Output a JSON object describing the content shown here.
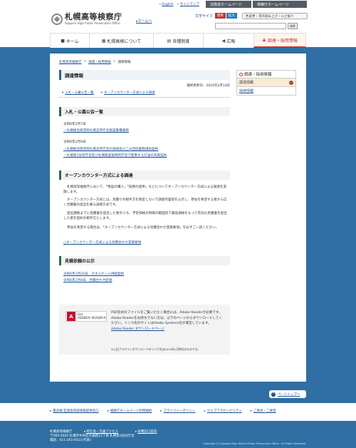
{
  "header": {
    "logo_jp": "札幌高等検察庁",
    "logo_en": "Sapporo High Public Prosecutors Office",
    "home_link": "ホームへ",
    "top_links": [
      "English",
      "サイトマップ"
    ],
    "moj_tab": "法務省ホームページ",
    "kensatsu_tab": "検察庁ホームページ",
    "font_size_label": "文字サイズ",
    "font_std": "標準",
    "font_big": "拡大",
    "ua_button": "色変更・音声読み上げ・ルビ振り",
    "search_button": "検索",
    "search_value": ""
  },
  "gnav": [
    {
      "icon": "home-icon",
      "glyph": "■",
      "label": "ホーム",
      "active": false
    },
    {
      "icon": "building-icon",
      "glyph": "▦",
      "label": "札幌高検について",
      "active": false
    },
    {
      "icon": "system-icon",
      "glyph": "▤",
      "label": "各種制度",
      "active": false
    },
    {
      "icon": "megaphone-icon",
      "glyph": "◀",
      "label": "広報",
      "active": false
    },
    {
      "icon": "person-icon",
      "glyph": "♟",
      "label": "調達・採用情報",
      "active": true
    }
  ],
  "breadcrumb": [
    "札幌高等検察庁",
    "調達・採用情報",
    "調達情報"
  ],
  "page_title": "調達情報",
  "updated": "最終更新日：2024年2月14日",
  "anchors": [
    "入札・公募公告一覧",
    "オープンカウンター方式による調達"
  ],
  "sec1": {
    "title": "入札・公募公告一覧",
    "date1": "令和6年2月7日",
    "link1": "・札幌総合研究所札幌支所庁舎施設警備業務",
    "date2": "令和6年2月9日",
    "link2": "・札幌総合研究所札幌支所庁舎の清掃及びごみ回収業務請負契約",
    "link3": "・札幌第3合同庁舎及び札幌家庭裁判所庁舎で使用する灯油の売買契約"
  },
  "sec2": {
    "title": "オープンカウンター方式による調達",
    "p1": "札幌高等検察庁において、「物品の購入」「役務の提供」などについてオープンカウンター方式による調達を実施します。",
    "p2": "オープンカウンター方式とは、見積りの相手方を限定しないで調達内容等を公示し、参加を希望する者から広く見積書の提出を募る調達方式です。",
    "p3": "提出期限までに見積書を提出した者のうち、予定価格の制限の範囲内で最低価格をもって有効な見積書を提出した者を契約の相手方とします。",
    "p4": "参加を希望する場合は、「オープンカウンター方式による見積合わせ実施要領」を必ずご一読ください。",
    "link": "○オープンカウンター方式による見積合わせ実施要領"
  },
  "sec3": {
    "title": "見積依頼の公示",
    "link1": "令和6年1月24日　タオルケット供給契約",
    "link2": "令和6年2月8日　見積合わせ結果"
  },
  "adobe": {
    "logo_small": "Get",
    "logo_text": "ADOBE® READER®",
    "line1": "PDF形式のファイルをご覧いただく場合には、Adobe Readerが必要です。",
    "line2": "Adobe Readerをお持ちでない方は、以下のページからダウンロードしてください。リンク先のサイトはAdobe Systems社が運営しています。",
    "dl_link": "Adobe Reader ダウンロードページ",
    "note": "※上記プラグインダウンロードのリンク先は2015年1月時点のものです。"
  },
  "side": {
    "heading": "調達・採用情報",
    "items": [
      {
        "label": "調達情報",
        "active": true
      },
      {
        "label": "採用情報",
        "active": false
      }
    ]
  },
  "pagetop": "ページトップへ",
  "footnav": [
    "最高検 監督指導部情報提供窓口",
    "検察庁ホームページ利用規約",
    "プライバシーポリシー",
    "ウェブアクセシビリティ",
    "ご意見・ご要望"
  ],
  "footer": {
    "office": "札幌高等検察庁",
    "address": "〒060-0042 札幌市中央区大通西12丁目 札幌第3合同庁舎",
    "tel": "電話：011-261-9311(代表)",
    "link1": "所在地・交通アクセス",
    "link2": "各種窓口案内",
    "copyright": "Copyright (C) Sapporo High District Public Prosecutors Office . All Rights Reserved."
  }
}
